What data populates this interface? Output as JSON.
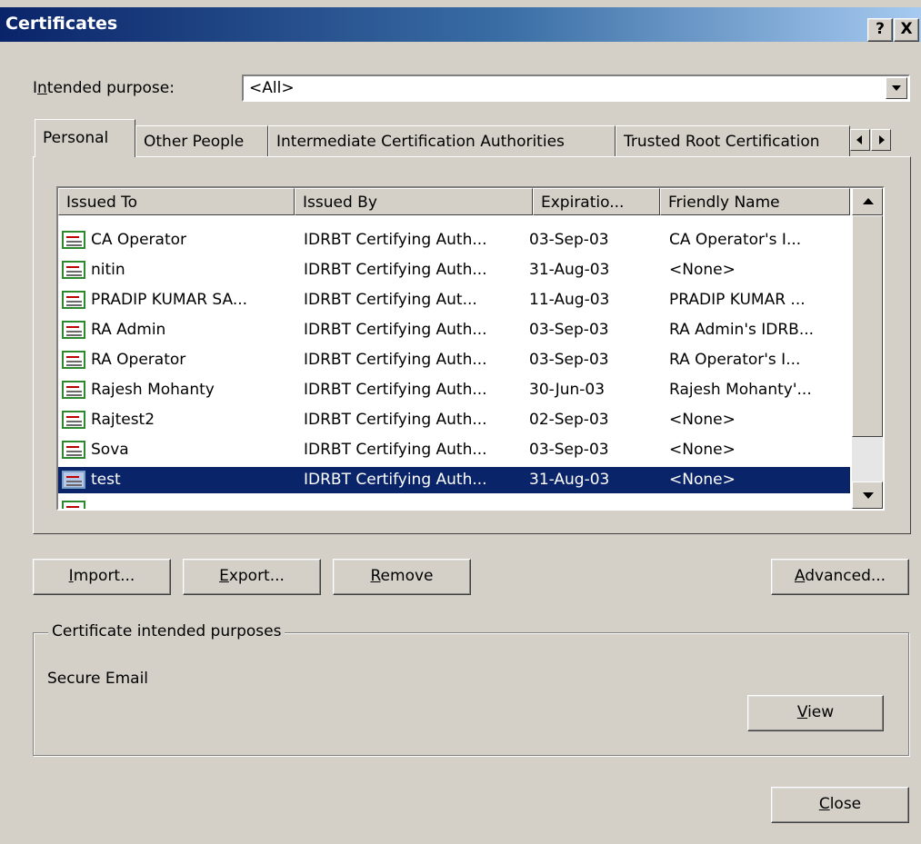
{
  "window": {
    "title": "Certificates",
    "help_label": "?",
    "close_glyph": "X"
  },
  "purpose": {
    "label_before": "I",
    "label_accel": "n",
    "label_after": "tended purpose:",
    "value": "<All>"
  },
  "tabs": [
    {
      "label": "Personal",
      "active": true
    },
    {
      "label": "Other People",
      "active": false
    },
    {
      "label": "Intermediate Certification Authorities",
      "active": false
    },
    {
      "label": "Trusted Root Certification",
      "active": false
    }
  ],
  "table": {
    "columns": [
      "Issued To",
      "Issued By",
      "Expiratio...",
      "Friendly Name"
    ],
    "rows": [
      {
        "issued_to": "CA Operator",
        "issued_by": "IDRBT Certifying Auth...",
        "expiration": "03-Sep-03",
        "friendly": "CA Operator's I..."
      },
      {
        "issued_to": "nitin",
        "issued_by": "IDRBT Certifying Auth...",
        "expiration": "31-Aug-03",
        "friendly": "<None>"
      },
      {
        "issued_to": "PRADIP KUMAR SA...",
        "issued_by": "IDRBT Certifying  Aut...",
        "expiration": "11-Aug-03",
        "friendly": "PRADIP KUMAR ..."
      },
      {
        "issued_to": "RA Admin",
        "issued_by": "IDRBT Certifying Auth...",
        "expiration": "03-Sep-03",
        "friendly": "RA Admin's IDRB..."
      },
      {
        "issued_to": "RA Operator",
        "issued_by": "IDRBT Certifying Auth...",
        "expiration": "03-Sep-03",
        "friendly": "RA Operator's I..."
      },
      {
        "issued_to": "Rajesh Mohanty",
        "issued_by": "IDRBT Certifying Auth...",
        "expiration": "30-Jun-03",
        "friendly": "Rajesh Mohanty'..."
      },
      {
        "issued_to": "Rajtest2",
        "issued_by": "IDRBT Certifying Auth...",
        "expiration": "02-Sep-03",
        "friendly": "<None>"
      },
      {
        "issued_to": "Sova",
        "issued_by": "IDRBT Certifying Auth...",
        "expiration": "03-Sep-03",
        "friendly": "<None>"
      },
      {
        "issued_to": "test",
        "issued_by": "IDRBT Certifying Auth...",
        "expiration": "31-Aug-03",
        "friendly": "<None>",
        "selected": true
      }
    ]
  },
  "buttons": {
    "import": {
      "accel": "I",
      "rest": "mport..."
    },
    "export": {
      "accel": "E",
      "rest": "xport..."
    },
    "remove": {
      "accel": "R",
      "rest": "emove"
    },
    "advanced": {
      "accel": "A",
      "rest": "dvanced..."
    },
    "view": {
      "accel": "V",
      "rest": "iew"
    },
    "close": {
      "accel": "C",
      "rest": "lose"
    }
  },
  "purposes_group": {
    "title": "Certificate intended purposes",
    "text": "Secure Email"
  },
  "colors": {
    "title_start": "#0a246a",
    "title_end": "#a6caf0",
    "face": "#d4d0c8",
    "selection": "#0a246a",
    "outer": "#ffffc8"
  }
}
